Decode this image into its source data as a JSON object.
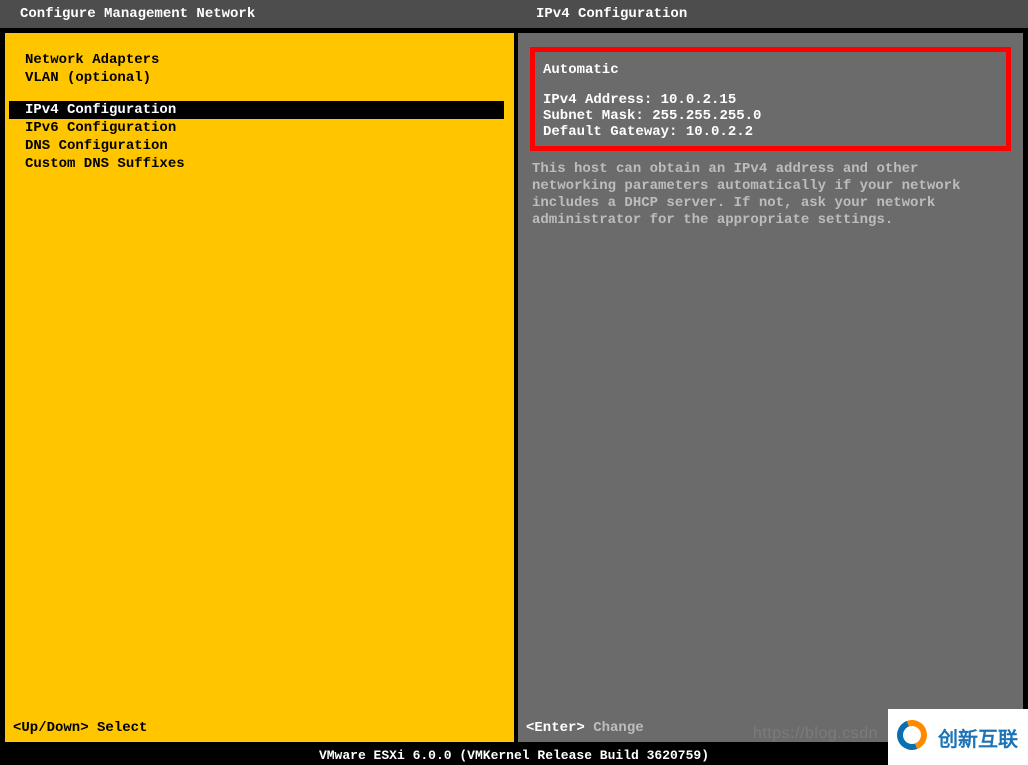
{
  "left": {
    "title": "Configure Management Network",
    "items": [
      "Network Adapters",
      "VLAN (optional)",
      "IPv4 Configuration",
      "IPv6 Configuration",
      "DNS Configuration",
      "Custom DNS Suffixes"
    ],
    "footer_key": "<Up/Down>",
    "footer_action": "Select"
  },
  "right": {
    "title": "IPv4 Configuration",
    "mode": "Automatic",
    "rows": {
      "ip_label": "IPv4 Address:",
      "ip_value": "10.0.2.15",
      "mask_label": "Subnet Mask:",
      "mask_value": "255.255.255.0",
      "gw_label": "Default Gateway:",
      "gw_value": "10.0.2.2"
    },
    "description": "This host can obtain an IPv4 address and other networking parameters automatically if your network includes a DHCP server. If not, ask your network administrator for the appropriate settings.",
    "footer_key": "<Enter>",
    "footer_action": "Change"
  },
  "status_bar": "VMware ESXi 6.0.0 (VMKernel Release Build 3620759)",
  "watermark_url": "https://blog.csdn",
  "brand_text": "创新互联"
}
